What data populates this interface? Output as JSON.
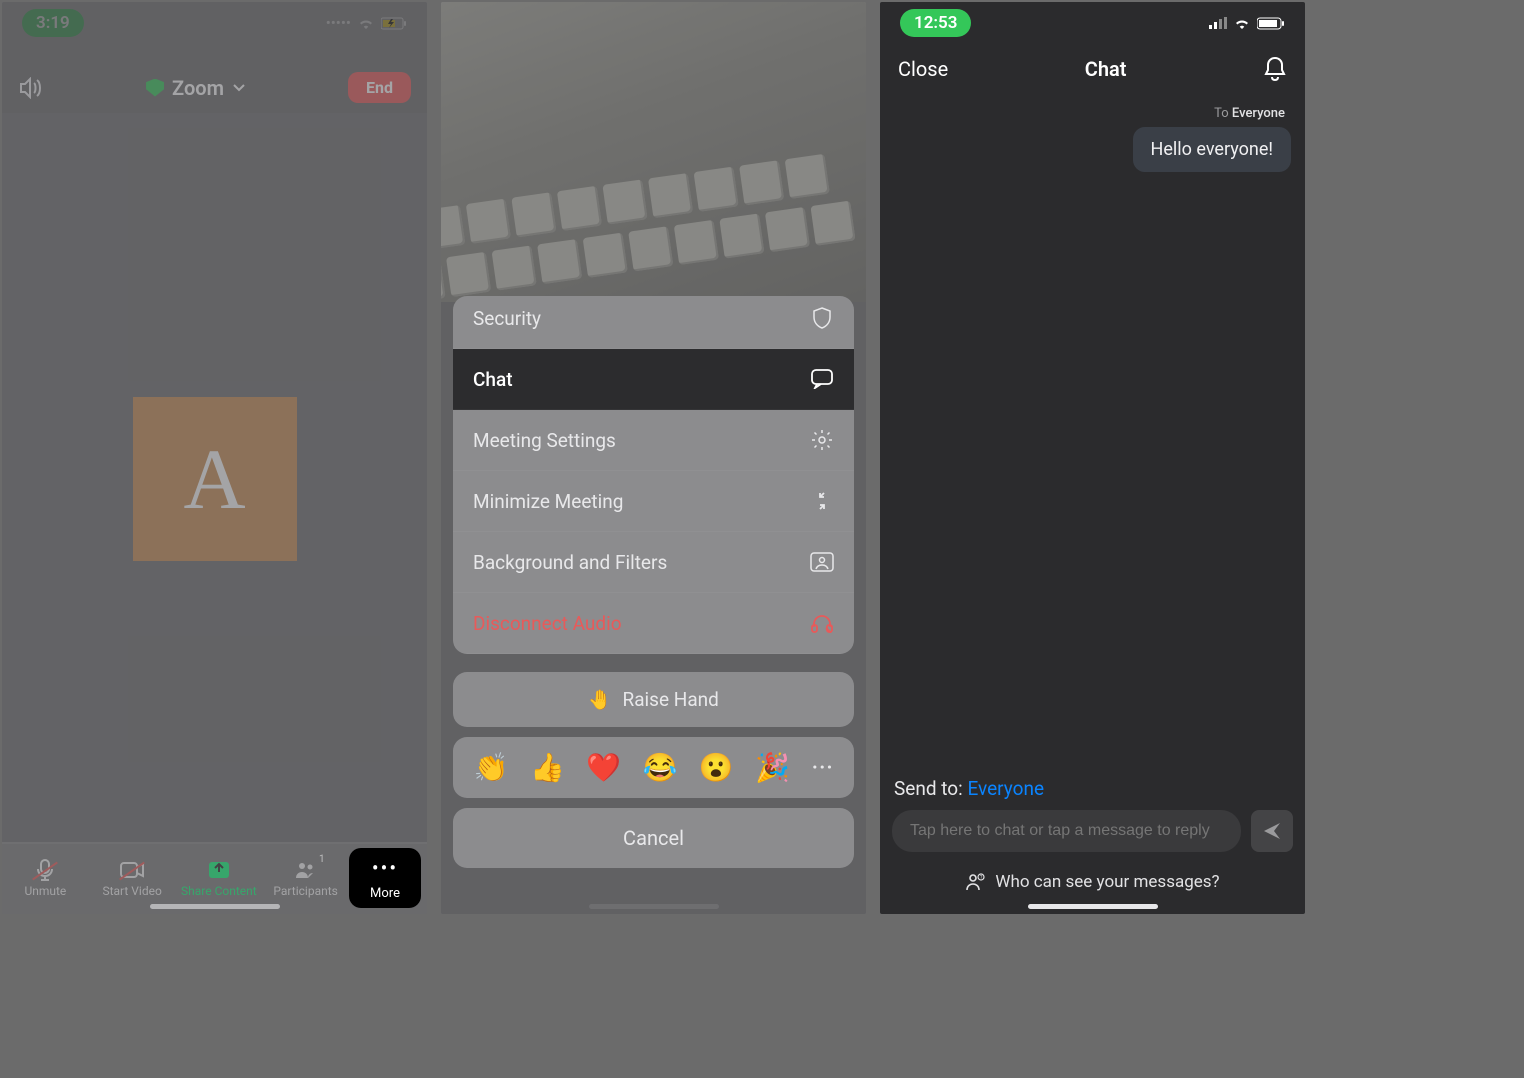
{
  "screen1": {
    "time": "3:19",
    "zoom_label": "Zoom",
    "end_label": "End",
    "avatar_letter": "A",
    "toolbar": {
      "unmute": "Unmute",
      "startvideo": "Start Video",
      "share": "Share Content",
      "participants": "Participants",
      "participants_count": "1",
      "more": "More"
    }
  },
  "screen2": {
    "menu": {
      "security": "Security",
      "chat": "Chat",
      "settings": "Meeting Settings",
      "minimize": "Minimize Meeting",
      "background": "Background and Filters",
      "disconnect": "Disconnect Audio"
    },
    "raise_label": "Raise Hand",
    "raise_emoji": "🤚",
    "emojis": [
      "👏",
      "👍",
      "❤️",
      "😂",
      "😮",
      "🎉",
      "···"
    ],
    "cancel": "Cancel"
  },
  "screen3": {
    "time": "12:53",
    "close": "Close",
    "title": "Chat",
    "msg_to_label": "To",
    "msg_to_value": "Everyone",
    "message": "Hello everyone!",
    "sendto_label": "Send to:",
    "sendto_value": "Everyone",
    "placeholder": "Tap here to chat or tap a message to reply",
    "who": "Who can see your messages?"
  }
}
